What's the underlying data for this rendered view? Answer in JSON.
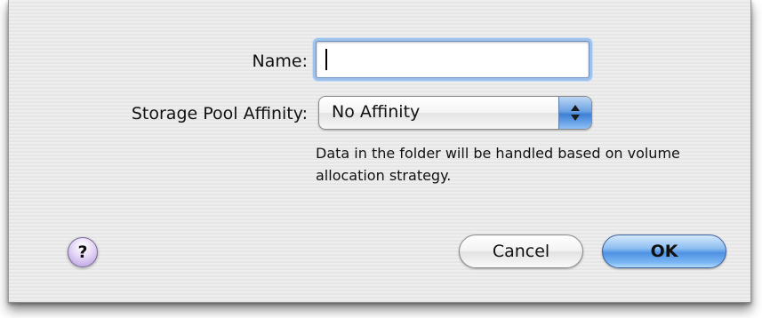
{
  "dialog": {
    "name_label": "Name:",
    "name_value": "",
    "affinity_label": "Storage Pool Affinity:",
    "affinity_selected": "No Affinity",
    "affinity_help_text": "Data in the folder will be handled based on volume allocation strategy.",
    "help_icon": "question-mark-icon",
    "help_glyph": "?",
    "cancel_label": "Cancel",
    "ok_label": "OK"
  },
  "colors": {
    "focus_ring": "#9fc2ec",
    "default_button": "#4f92e2",
    "help_button": "#c5aee8"
  }
}
